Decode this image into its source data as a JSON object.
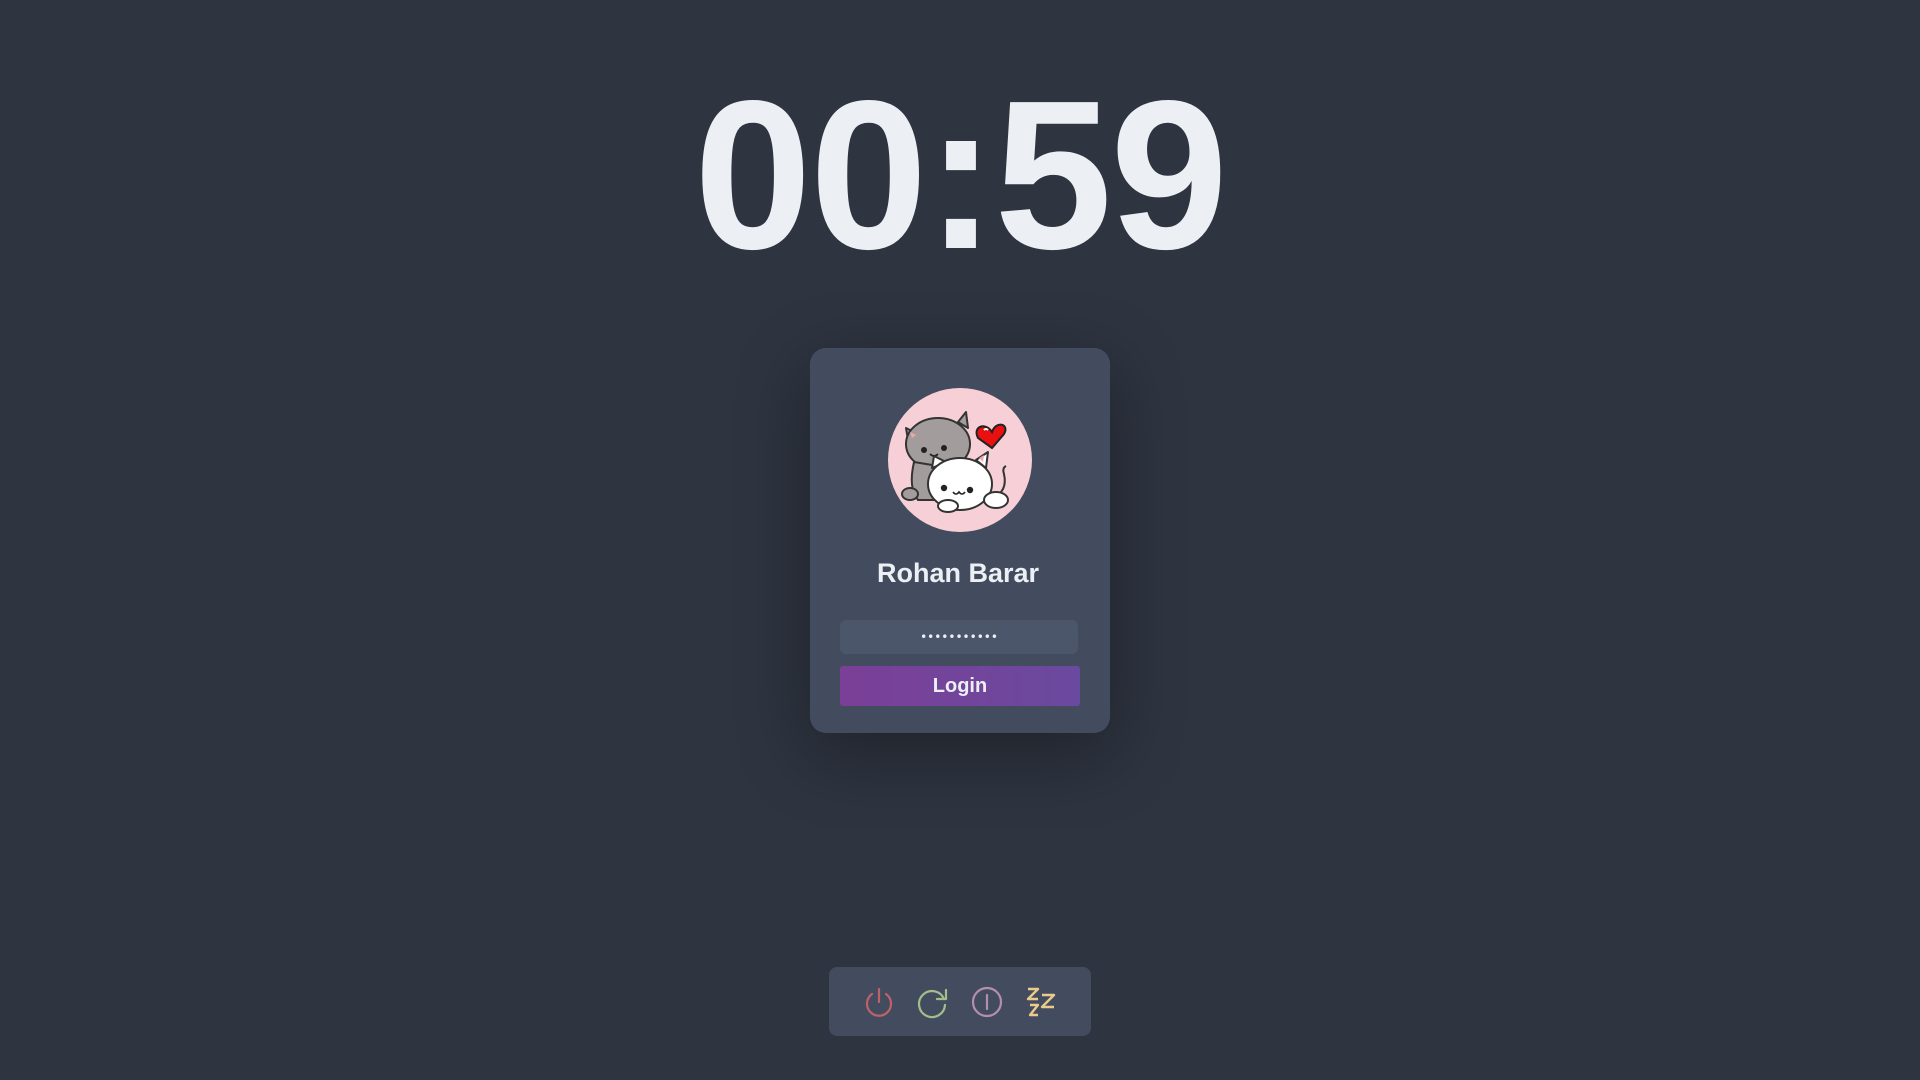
{
  "clock": {
    "time": "00:59"
  },
  "login_card": {
    "username": "Rohan Barar",
    "password_masked": "•••••••••••",
    "login_label": "Login"
  },
  "avatar": {
    "description_icon": "cats-heart-avatar"
  },
  "power_menu": {
    "items": [
      {
        "icon": "power-icon",
        "color": "#bf616a"
      },
      {
        "icon": "restart-icon",
        "color": "#a3be8c"
      },
      {
        "icon": "logout-icon",
        "color": "#b48ead"
      },
      {
        "icon": "sleep-icon",
        "color": "#ebcb8b"
      }
    ]
  },
  "colors": {
    "background": "#2e3440",
    "card": "#434c5e",
    "text": "#eceff4",
    "button_gradient_start": "#7b3f98",
    "button_gradient_end": "#6a4a9e"
  }
}
